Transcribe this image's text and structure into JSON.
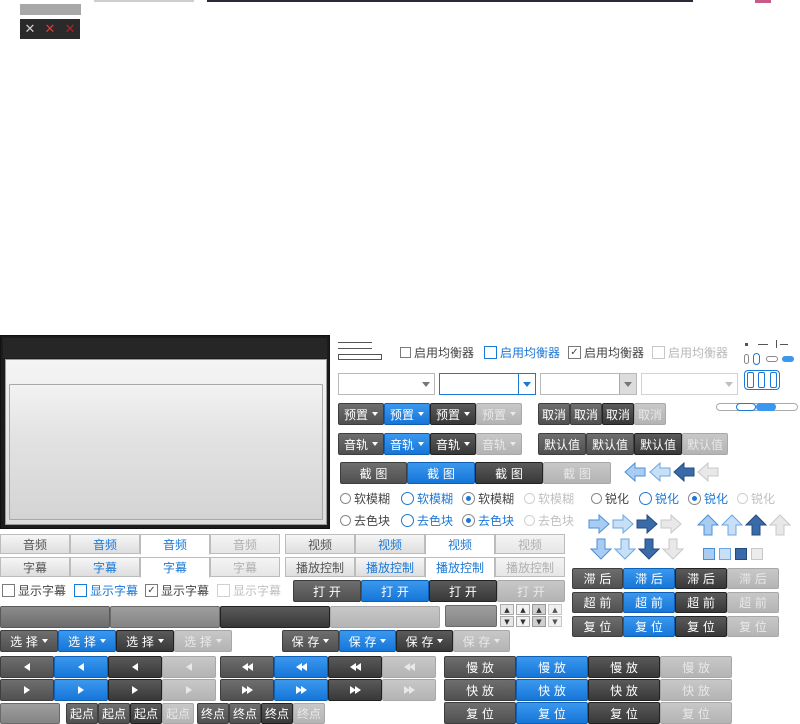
{
  "equalizer": {
    "enable_label": "启用均衡器",
    "preset_label": "预置",
    "cancel_label": "取消",
    "default_label": "默认值"
  },
  "audio_track_label": "音轨",
  "screenshot_label": "截 图",
  "filters": {
    "soft_blur_label": "软模糊",
    "sharpen_label": "锐化",
    "deblock_label": "去色块"
  },
  "tabs": {
    "audio": "音频",
    "video": "视频",
    "subtitle": "字幕",
    "playback_control": "播放控制"
  },
  "subtitle": {
    "show_subtitle_label": "显示字幕",
    "select_label": "选 择",
    "save_label": "保 存"
  },
  "actions": {
    "open_label": "打 开",
    "delay_label": "滞 后",
    "advance_label": "超 前",
    "reset_label": "复 位",
    "slow_label": "慢 放",
    "fast_label": "快 放",
    "start_point_label": "起点",
    "end_point_label": "终点"
  },
  "colors": {
    "accent_blue": "#1a78d6",
    "dark_button": "#5e5e5e",
    "disabled_button": "#bdbdbd"
  }
}
